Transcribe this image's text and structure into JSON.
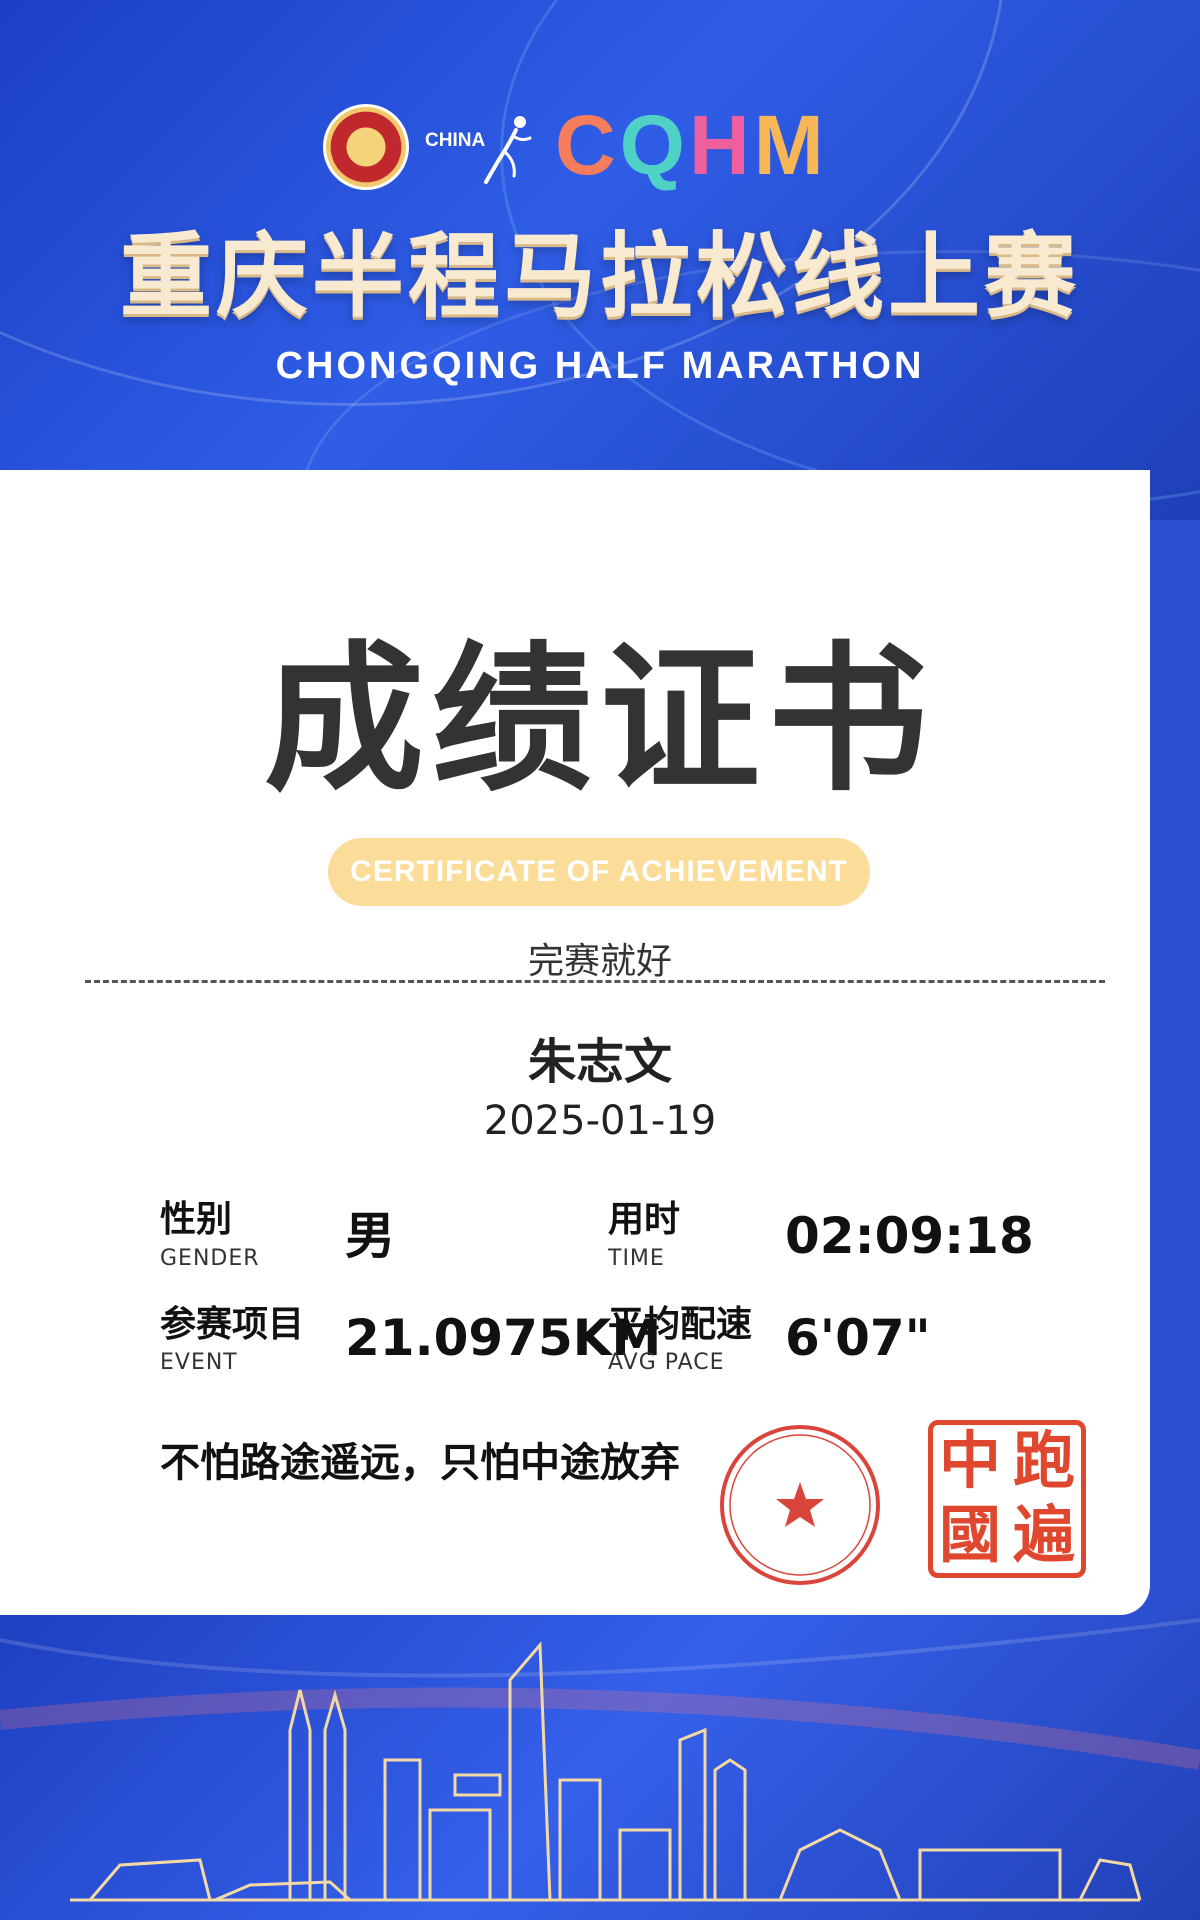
{
  "header": {
    "org_logo_icon": "chinese-athletics-association-logo",
    "china_marathon_text": "CHINA",
    "cqhm_logo_letters": [
      "C",
      "Q",
      "H",
      "M"
    ],
    "title": "重庆半程马拉松线上赛",
    "subtitle": "CHONGQING HALF MARATHON"
  },
  "certificate": {
    "title": "成绩证书",
    "badge": "CERTIFICATE OF ACHIEVEMENT",
    "status": "完赛就好",
    "name": "朱志文",
    "date": "2025-01-19",
    "fields": {
      "gender": {
        "label": "性别",
        "sub": "GENDER",
        "value": "男"
      },
      "time": {
        "label": "用时",
        "sub": "TIME",
        "value": "02:09:18"
      },
      "event": {
        "label": "参赛项目",
        "sub": "EVENT",
        "value": "21.0975KM"
      },
      "pace": {
        "label": "平均配速",
        "sub": "AVG PACE",
        "value": "6'07\""
      }
    },
    "motto": "不怕路途遥远，只怕中途放弃",
    "stamp_chars": [
      "中",
      "跑",
      "國",
      "遍"
    ]
  },
  "colors": {
    "banner_blue": "#2a4fd0",
    "badge_yellow": "#fbdc98",
    "stamp_red": "#e0472f"
  }
}
